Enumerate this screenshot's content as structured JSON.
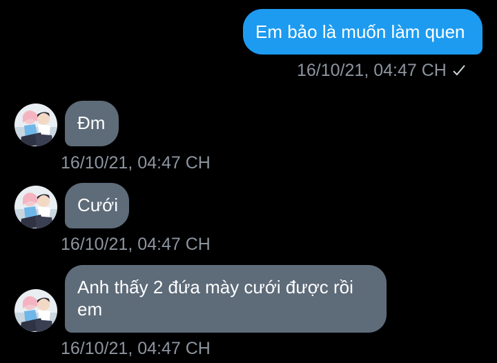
{
  "messages": [
    {
      "direction": "outgoing",
      "text": "Em bảo là muốn làm quen",
      "timestamp": "16/10/21, 04:47 CH",
      "status_icon": "check-icon"
    },
    {
      "direction": "incoming",
      "text": "Đm",
      "timestamp": "16/10/21, 04:47 CH"
    },
    {
      "direction": "incoming",
      "text": "Cưới",
      "timestamp": "16/10/21, 04:47 CH"
    },
    {
      "direction": "incoming",
      "text": "Anh thấy 2 đứa mày cưới được rồi em",
      "timestamp": "16/10/21, 04:47 CH"
    }
  ],
  "colors": {
    "background": "#000000",
    "outgoing_bubble": "#1d9bf0",
    "incoming_bubble": "#5e6b79",
    "timestamp": "#8c95a0"
  }
}
